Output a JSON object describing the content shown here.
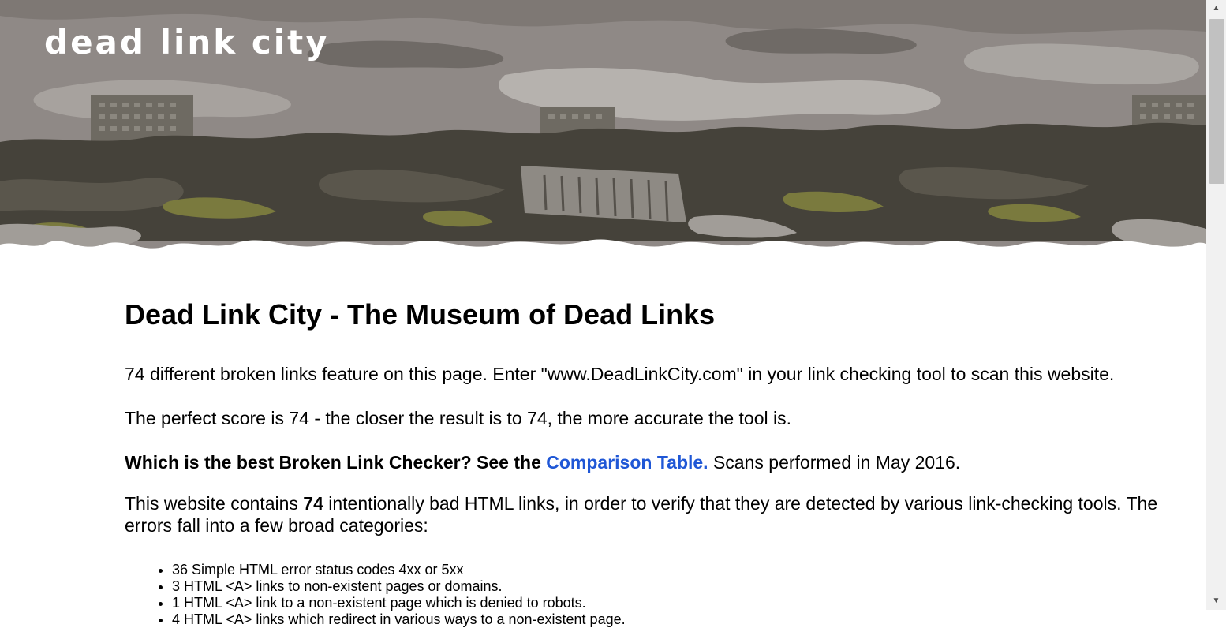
{
  "banner": {
    "logo_text": "Dead Link City"
  },
  "main": {
    "heading": "Dead Link City - The Museum of Dead Links",
    "intro": "74 different broken links feature on this page. Enter \"www.DeadLinkCity.com\" in your link checking tool to scan this website.",
    "score": "The perfect score is 74 - the closer the result is to 74, the more accurate the tool is.",
    "question": "Which is the best Broken Link Checker? See the",
    "comparison_link": "Comparison Table.",
    "scans_date": " Scans performed in May 2016.",
    "contains_before": "This website contains ",
    "contains_count": "74",
    "contains_after": " intentionally bad HTML links, in order to verify that they are detected by various link-checking tools. The errors fall into a few broad categories:",
    "categories": [
      "36 Simple HTML error status codes 4xx or 5xx",
      "3 HTML <A> links to non-existent pages or domains.",
      "1 HTML <A> link to a non-existent page which is denied to robots.",
      "4 HTML <A> links which redirect in various ways to a non-existent page."
    ]
  },
  "colors": {
    "link": "#1f57d6",
    "banner_sky": "#8f8986",
    "banner_dark": "#45423a",
    "banner_moss": "#7a7a3e"
  },
  "scrollbar": {
    "up_icon": "triangle-up",
    "down_icon": "triangle-down"
  }
}
